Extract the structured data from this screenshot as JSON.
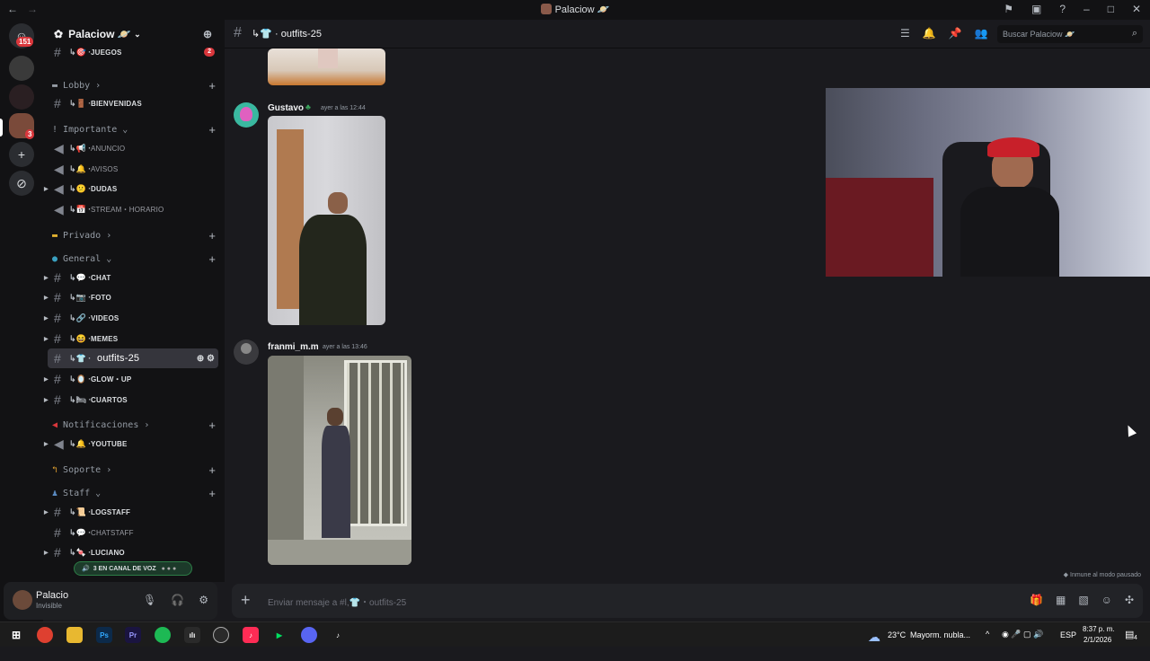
{
  "window": {
    "title": "Palaciow",
    "title_emoji": "🪐"
  },
  "rail": {
    "dm_badge": "151",
    "server_badge": "3"
  },
  "server": {
    "name": "Palaciow",
    "name_emoji": "🪐"
  },
  "sidebar": {
    "top_channel": {
      "name": "JUEGOS",
      "emoji": "🎯",
      "count": "2"
    },
    "categories": {
      "lobby": "Lobby",
      "importante": "Importante",
      "privado": "Privado",
      "general": "General",
      "notificaciones": "Notificaciones",
      "soporte": "Soporte",
      "staff": "Staff"
    },
    "channels": [
      {
        "name": "BIENVENIDAS",
        "emoji": "🚪"
      },
      {
        "name": "ANUNCIO",
        "emoji": "📢"
      },
      {
        "name": "AVISOS",
        "emoji": "🔔"
      },
      {
        "name": "DUDAS",
        "emoji": "😕"
      },
      {
        "name": "STREAM・HORARIO",
        "emoji": "📅"
      },
      {
        "name": "CHAT",
        "emoji": "💬"
      },
      {
        "name": "FOTO",
        "emoji": "📷"
      },
      {
        "name": "VIDEOS",
        "emoji": "🔗"
      },
      {
        "name": "MEMES",
        "emoji": "😆"
      },
      {
        "name": "outfits-25",
        "emoji": "👕"
      },
      {
        "name": "GLOW・UP",
        "emoji": "🪞"
      },
      {
        "name": "CUARTOS",
        "emoji": "🛏"
      },
      {
        "name": "YOUTUBE",
        "emoji": "🔔"
      },
      {
        "name": "LOGSTAFF",
        "emoji": "📜"
      },
      {
        "name": "CHATSTAFF",
        "emoji": "💬"
      },
      {
        "name": "LUCIANO",
        "emoji": "🍬"
      }
    ],
    "voice_pill": "3 EN CANAL DE VOZ"
  },
  "user": {
    "name": "Palacio",
    "status": "Invisible"
  },
  "channel_header": {
    "name": "outfits-25",
    "search_placeholder": "Buscar Palaciow",
    "search_emoji": "🪐"
  },
  "messages": [
    {
      "author": "Gustavo",
      "timestamp": "ayer a las 12:44"
    },
    {
      "author": "franmi_m.m",
      "timestamp": "ayer a las 13:46"
    }
  ],
  "pause_note": "Inmune al modo pausado",
  "composer": {
    "placeholder": "Enviar mensaje a #l,👕・outfits-25"
  },
  "taskbar": {
    "weather_temp": "23°C",
    "weather_text": "Mayorm. nubla...",
    "lang": "ESP",
    "time": "8:37 p. m.",
    "date": "2/1/2026",
    "notif_count": "4"
  },
  "colors": {
    "accent_red": "#da373c",
    "voice_green": "#2d7d46",
    "bg": "#1a1a1e",
    "sidebar_bg": "#121214"
  }
}
